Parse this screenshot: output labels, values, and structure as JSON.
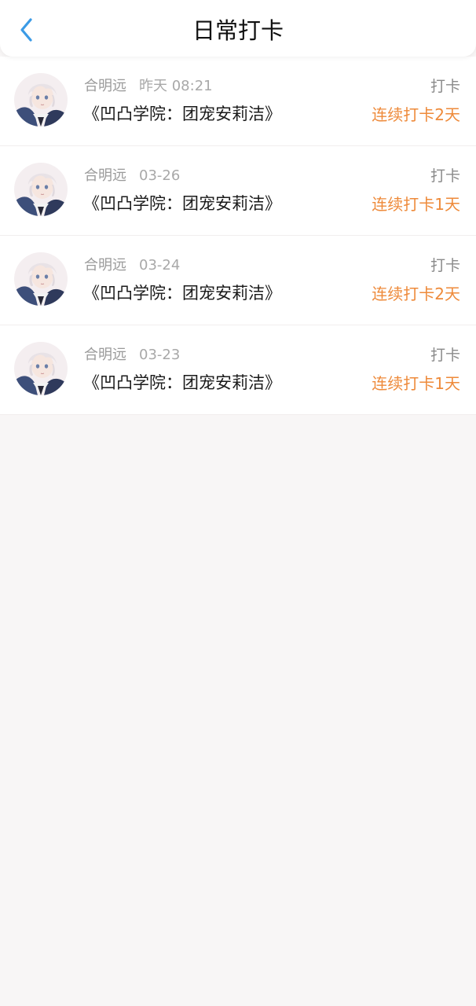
{
  "header": {
    "title": "日常打卡",
    "back_icon": "chevron-left-icon",
    "accent_color": "#3b9be6"
  },
  "entries": [
    {
      "user": "合明远",
      "date": "昨天 08:21",
      "book": "《凹凸学院：团宠安莉洁》",
      "tag": "打卡",
      "streak": "连续打卡2天"
    },
    {
      "user": "合明远",
      "date": "03-26",
      "book": "《凹凸学院：团宠安莉洁》",
      "tag": "打卡",
      "streak": "连续打卡1天"
    },
    {
      "user": "合明远",
      "date": "03-24",
      "book": "《凹凸学院：团宠安莉洁》",
      "tag": "打卡",
      "streak": "连续打卡2天"
    },
    {
      "user": "合明远",
      "date": "03-23",
      "book": "《凹凸学院：团宠安莉洁》",
      "tag": "打卡",
      "streak": "连续打卡1天"
    }
  ],
  "colors": {
    "streak": "#ee8a3a",
    "background": "#f8f6f6"
  }
}
